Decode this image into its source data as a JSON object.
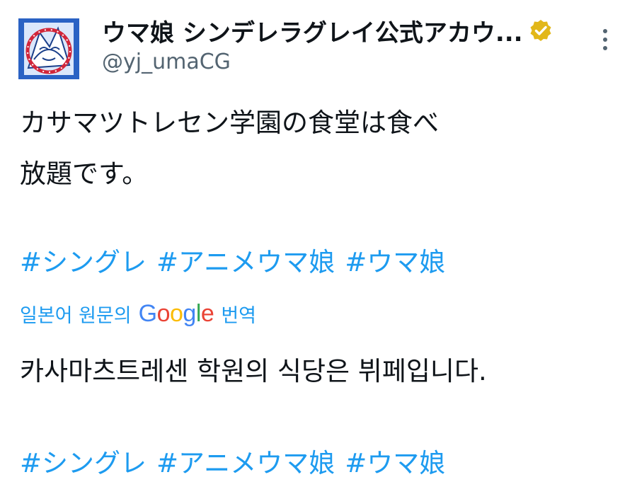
{
  "author": {
    "display_name": "ウマ娘 シンデレラグレイ公式アカウ...",
    "handle": "@yj_umaCG",
    "verified_badge_icon": "verified-gold-badge",
    "verified_color": "#e2b719"
  },
  "menu": {
    "more_icon": "more-vertical-icon"
  },
  "tweet": {
    "lines": [
      "カサマツトレセン学園の食堂は食べ",
      "放題です。"
    ],
    "hashtags": [
      "#シングレ",
      "#アニメウマ娘",
      "#ウマ娘"
    ]
  },
  "translation": {
    "prefix": "일본어 원문의",
    "provider": {
      "letters": [
        "G",
        "o",
        "o",
        "g",
        "l",
        "e"
      ]
    },
    "suffix": "번역",
    "text": "카사마츠트레센 학원의 식당은 뷔페입니다.",
    "hashtags": [
      "#シングレ",
      "#アニメウマ娘",
      "#ウマ娘"
    ]
  },
  "colors": {
    "link": "#1d9bf0",
    "text": "#0f1419",
    "secondary": "#536471"
  }
}
